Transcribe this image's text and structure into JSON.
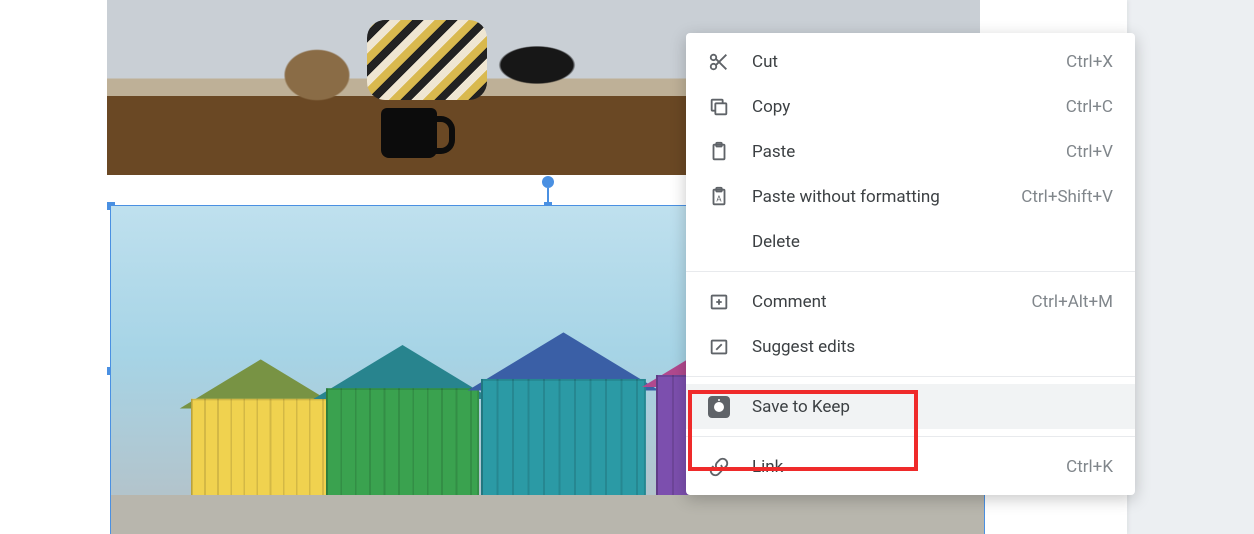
{
  "menu": {
    "items": [
      {
        "id": "cut",
        "label": "Cut",
        "shortcut": "Ctrl+X",
        "icon": "scissors-icon"
      },
      {
        "id": "copy",
        "label": "Copy",
        "shortcut": "Ctrl+C",
        "icon": "copy-icon"
      },
      {
        "id": "paste",
        "label": "Paste",
        "shortcut": "Ctrl+V",
        "icon": "clipboard-icon"
      },
      {
        "id": "paste-nf",
        "label": "Paste without formatting",
        "shortcut": "Ctrl+Shift+V",
        "icon": "clipboard-text-icon"
      },
      {
        "id": "delete",
        "label": "Delete",
        "shortcut": "",
        "icon": ""
      },
      {
        "sep": true
      },
      {
        "id": "comment",
        "label": "Comment",
        "shortcut": "Ctrl+Alt+M",
        "icon": "comment-icon"
      },
      {
        "id": "suggest",
        "label": "Suggest edits",
        "shortcut": "",
        "icon": "suggest-edits-icon"
      },
      {
        "sep": true
      },
      {
        "id": "keep",
        "label": "Save to Keep",
        "shortcut": "",
        "icon": "keep-icon",
        "highlighted": true
      },
      {
        "sep": true
      },
      {
        "id": "link",
        "label": "Link",
        "shortcut": "Ctrl+K",
        "icon": "link-icon"
      }
    ]
  },
  "annotation": {
    "highlight": "Save to Keep"
  }
}
